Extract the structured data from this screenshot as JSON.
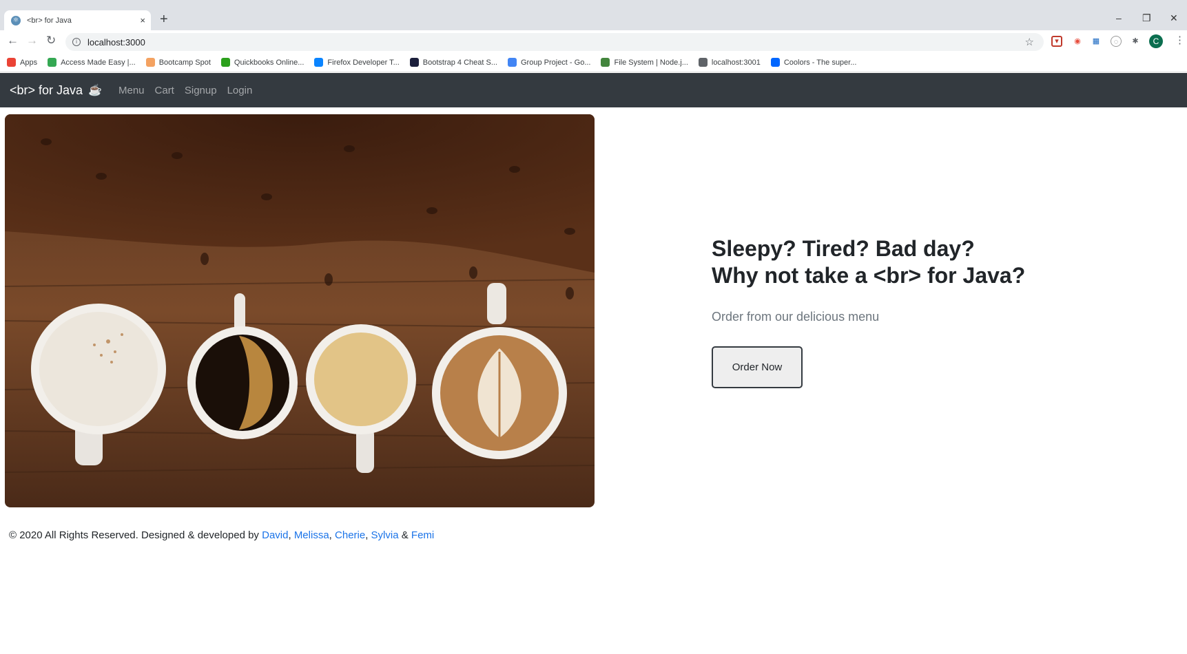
{
  "browser": {
    "tab_title": "<br> for Java",
    "tab_close": "×",
    "new_tab": "+",
    "url": "localhost:3000",
    "window_controls": [
      "–",
      "❐",
      "✕"
    ],
    "profile_initial": "C",
    "bookmarks": [
      {
        "label": "Apps",
        "icon": "apps-grid-icon",
        "color": "#ea4335"
      },
      {
        "label": "Access Made Easy |...",
        "icon": "site-icon",
        "color": "#34a853"
      },
      {
        "label": "Bootcamp Spot",
        "icon": "site-icon",
        "color": "#f4a261"
      },
      {
        "label": "Quickbooks Online...",
        "icon": "site-icon",
        "color": "#2ca01c"
      },
      {
        "label": "Firefox Developer T...",
        "icon": "site-icon",
        "color": "#0a84ff"
      },
      {
        "label": "Bootstrap 4 Cheat S...",
        "icon": "site-icon",
        "color": "#1b1f3b"
      },
      {
        "label": "Group Project - Go...",
        "icon": "docs-icon",
        "color": "#4285f4"
      },
      {
        "label": "File System | Node.j...",
        "icon": "node-icon",
        "color": "#43853d"
      },
      {
        "label": "localhost:3001",
        "icon": "globe-icon",
        "color": "#5f6368"
      },
      {
        "label": "Coolors - The super...",
        "icon": "site-icon",
        "color": "#0066ff"
      }
    ]
  },
  "site": {
    "brand": "<br> for Java",
    "brand_icon": "coffee-cup-icon",
    "nav": [
      "Menu",
      "Cart",
      "Signup",
      "Login"
    ],
    "hero_image": "coffee-cups-on-wooden-table",
    "headline_line1": "Sleepy? Tired? Bad day?",
    "headline_line2": "Why not take a <br> for Java?",
    "subline": "Order from our delicious menu",
    "order_button": "Order Now",
    "footer": {
      "prefix": "© 2020 All Rights Reserved. Designed & developed by",
      "authors": [
        "David",
        "Melissa",
        "Cherie",
        "Sylvia",
        "Femi"
      ],
      "comma": ",",
      "ampersand": "&"
    },
    "colors": {
      "navbar": "#343a40",
      "link": "#1a73e8"
    }
  }
}
